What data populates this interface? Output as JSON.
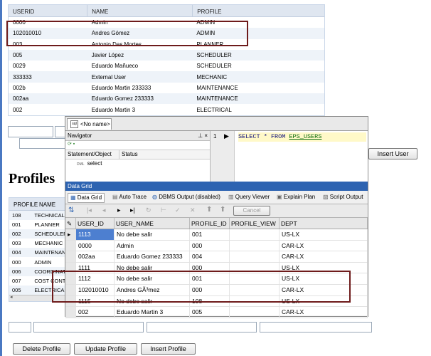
{
  "users_table": {
    "headers": [
      "USERID",
      "NAME",
      "PROFILE"
    ],
    "rows": [
      [
        "0000",
        "Admin",
        "ADMIN"
      ],
      [
        "102010010",
        "Andres Gómez",
        "ADMIN"
      ],
      [
        "003",
        "Antonio Das Mortes",
        "PLANNER"
      ],
      [
        "005",
        "Javier López",
        "SCHEDULER"
      ],
      [
        "0029",
        "Eduardo Mañueco",
        "SCHEDULER"
      ],
      [
        "333333",
        "External User",
        "MECHANIC"
      ],
      [
        "002b",
        "Eduardo Martin 233333",
        "MAINTENANCE"
      ],
      [
        "002aa",
        "Eduardo Gomez 233333",
        "MAINTENANCE"
      ],
      [
        "002",
        "Eduardo Martin 3",
        "ELECTRICAL"
      ]
    ]
  },
  "insert_user_label": "Insert User",
  "profiles_title": "Profiles",
  "profiles_table": {
    "headers": [
      "PROFILE",
      "NAME"
    ],
    "rows": [
      [
        "108",
        "TECHNICAL"
      ],
      [
        "001",
        "PLANNER"
      ],
      [
        "002",
        "SCHEDULER"
      ],
      [
        "003",
        "MECHANIC"
      ],
      [
        "004",
        "MAINTENANCE"
      ],
      [
        "000",
        "ADMIN"
      ],
      [
        "006",
        "COORDINATOR"
      ],
      [
        "007",
        "COST CONTROL"
      ],
      [
        "005",
        "ELECTRICAL"
      ]
    ]
  },
  "buttons": {
    "delete_profile": "Delete Profile",
    "update_profile": "Update Profile",
    "insert_profile": "Insert Profile"
  },
  "tool": {
    "tab": "<No name>",
    "navigator": "Navigator",
    "navigator_pin": "⊥ ×",
    "col_statement": "Statement/Object",
    "col_status": "Status",
    "statement_tag": "DML",
    "statement_text": "select",
    "line_number": "1",
    "sql_keyword_select": "SELECT",
    "sql_star": "*",
    "sql_keyword_from": "FROM",
    "sql_table": "EPS_USERS",
    "data_grid_title": "Data Grid",
    "tabs": [
      "Data Grid",
      "Auto Trace",
      "DBMS Output (disabled)",
      "Query Viewer",
      "Explain Plan",
      "Script Output"
    ],
    "cancel_label": "Cancel",
    "grid_headers": [
      "USER_ID",
      "USER_NAME",
      "PROFILE_ID",
      "PROFILE_VIEW",
      "DEPT"
    ],
    "grid_rows": [
      [
        "1113",
        "No debe salir",
        "001",
        "",
        "US-LX"
      ],
      [
        "0000",
        "Admin",
        "000",
        "",
        "CAR-LX"
      ],
      [
        "002aa",
        "Eduardo Gomez 233333",
        "004",
        "",
        "CAR-LX"
      ],
      [
        "1111",
        "No debe salir",
        "000",
        "",
        "US-LX"
      ],
      [
        "1112",
        "No debe salir",
        "001",
        "",
        "US-LX"
      ],
      [
        "102010010",
        "Andres GÃ³mez",
        "000",
        "",
        "CAR-LX"
      ],
      [
        "1115",
        "No debe salir",
        "108",
        "",
        "US-LX"
      ],
      [
        "002",
        "Eduardo Martin 3",
        "005",
        "",
        "CAR-LX"
      ]
    ]
  },
  "colors": {
    "accent": "#2d63b1",
    "highlight_border": "#6e1b1b",
    "sql_highlight": "#fff9c8"
  }
}
